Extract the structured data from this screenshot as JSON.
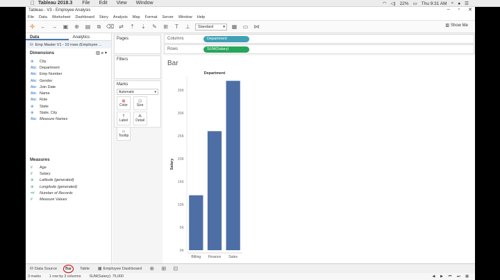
{
  "mac": {
    "app_name": "Tableau 2018.3",
    "menus": [
      "File",
      "Edit",
      "View",
      "Window"
    ],
    "battery": "22%",
    "clock": "Thu 9:31 AM"
  },
  "window": {
    "title": "Tableau - V3 - Employee Analysis"
  },
  "menubar": [
    "File",
    "Data",
    "Worksheet",
    "Dashboard",
    "Story",
    "Analysis",
    "Map",
    "Format",
    "Server",
    "Window",
    "Help"
  ],
  "toolbar": {
    "fit": "Standard",
    "show_me": "Show Me"
  },
  "left": {
    "tab_data": "Data",
    "tab_analytics": "Analytics",
    "datasource": "Emp Master V1 - 10 rows (Employee ...",
    "dimensions_title": "Dimensions",
    "dimensions": [
      {
        "icon": "globe",
        "label": "City"
      },
      {
        "icon": "abc",
        "label": "Department"
      },
      {
        "icon": "abc",
        "label": "Emp Number"
      },
      {
        "icon": "abc",
        "label": "Gender"
      },
      {
        "icon": "abc",
        "label": "Join Date"
      },
      {
        "icon": "abc",
        "label": "Name"
      },
      {
        "icon": "abc",
        "label": "Role"
      },
      {
        "icon": "globe",
        "label": "State"
      },
      {
        "icon": "globe",
        "label": "State, City"
      },
      {
        "icon": "abc",
        "label": "Measure Names"
      }
    ],
    "measures_title": "Measures",
    "measures": [
      {
        "icon": "#",
        "label": "Age"
      },
      {
        "icon": "#",
        "label": "Salary"
      },
      {
        "icon": "globe",
        "label": "Latitude (generated)"
      },
      {
        "icon": "globe",
        "label": "Longitude (generated)"
      },
      {
        "icon": "=#",
        "label": "Number of Records"
      },
      {
        "icon": "#",
        "label": "Measure Values"
      }
    ]
  },
  "shelves": {
    "pages": "Pages",
    "filters": "Filters",
    "marks": "Marks",
    "marks_type": "Automatic",
    "buttons": [
      "Color",
      "Size",
      "Label",
      "Detail",
      "Tooltip"
    ],
    "columns_label": "Columns",
    "rows_label": "Rows",
    "columns_pill": "Department",
    "rows_pill": "SUM(Salary)",
    "colors": {
      "dimension_pill": "#3fa1b6",
      "measure_pill": "#26a65b"
    }
  },
  "view": {
    "title": "Bar"
  },
  "chart_data": {
    "type": "bar",
    "title": "Department",
    "ylabel": "Salary",
    "categories": [
      "Billing",
      "Finance",
      "Sales"
    ],
    "values": [
      12000,
      26000,
      37000
    ],
    "ylim": [
      0,
      38000
    ],
    "yticks": [
      0,
      5000,
      10000,
      15000,
      20000,
      25000,
      30000,
      35000
    ],
    "ytick_labels": [
      "0K",
      "5K",
      "10K",
      "15K",
      "20K",
      "25K",
      "30K",
      "35K"
    ],
    "bar_color": "#4e6fa5"
  },
  "bottom_tabs": [
    "Data Source",
    "Bar",
    "Table",
    "Employee Dashboard"
  ],
  "status": [
    "3 marks",
    "1 row by 3 columns",
    "SUM(Salary): 75,000"
  ]
}
